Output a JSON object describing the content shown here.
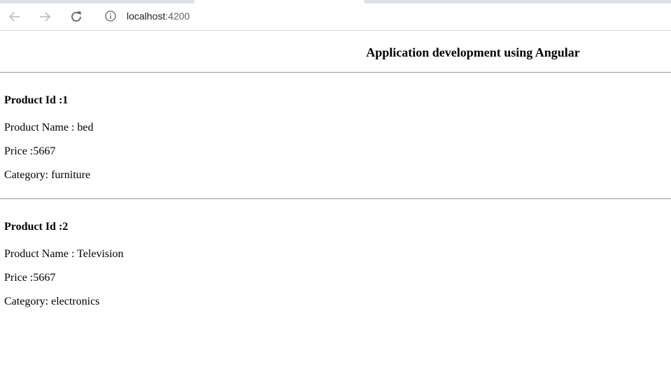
{
  "browser": {
    "url_host": "localhost",
    "url_port": ":4200"
  },
  "page": {
    "title": "Application development using Angular",
    "products": [
      {
        "id_label": "Product Id :1",
        "name_label": "Product Name : bed",
        "price_label": "Price :5667",
        "category_label": "Category: furniture"
      },
      {
        "id_label": "Product Id :2",
        "name_label": "Product Name : Television",
        "price_label": "Price :5667",
        "category_label": "Category: electronics"
      }
    ]
  },
  "icons": {
    "back": "arrow-left",
    "forward": "arrow-right",
    "reload": "reload",
    "site_info": "info-circle"
  },
  "colors": {
    "chrome_border": "#dadce0",
    "disabled_nav": "#bdc1c6",
    "icon": "#5f6368",
    "rule": "#9a9a9a"
  }
}
